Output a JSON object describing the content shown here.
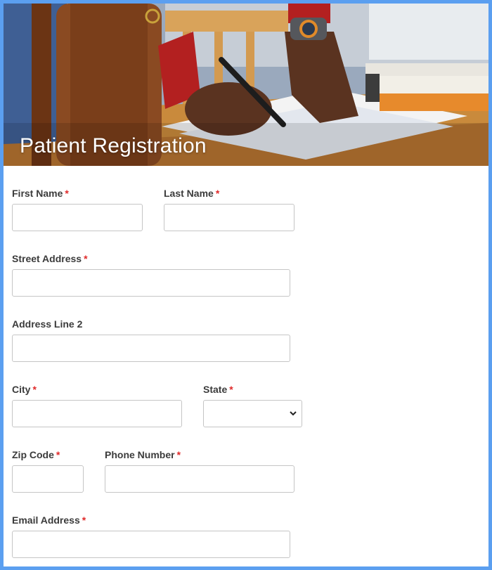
{
  "form": {
    "title": "Patient Registration",
    "required_mark": "*",
    "fields": {
      "first_name": {
        "label": "First Name",
        "value": ""
      },
      "last_name": {
        "label": "Last Name",
        "value": ""
      },
      "street_address": {
        "label": "Street Address",
        "value": ""
      },
      "address_line_2": {
        "label": "Address Line 2",
        "value": ""
      },
      "city": {
        "label": "City",
        "value": ""
      },
      "state": {
        "label": "State",
        "value": ""
      },
      "zip_code": {
        "label": "Zip Code",
        "value": ""
      },
      "phone_number": {
        "label": "Phone Number",
        "value": ""
      },
      "email_address": {
        "label": "Email Address",
        "value": ""
      }
    }
  },
  "colors": {
    "frame_border": "#5b9ff0",
    "required": "#e02a2a",
    "label": "#3b3b3b",
    "input_border": "#c5c5c5"
  },
  "icons": {
    "state_select": "chevron-down-icon"
  },
  "hero_image": {
    "subject": "hands-writing-on-form-photo"
  }
}
